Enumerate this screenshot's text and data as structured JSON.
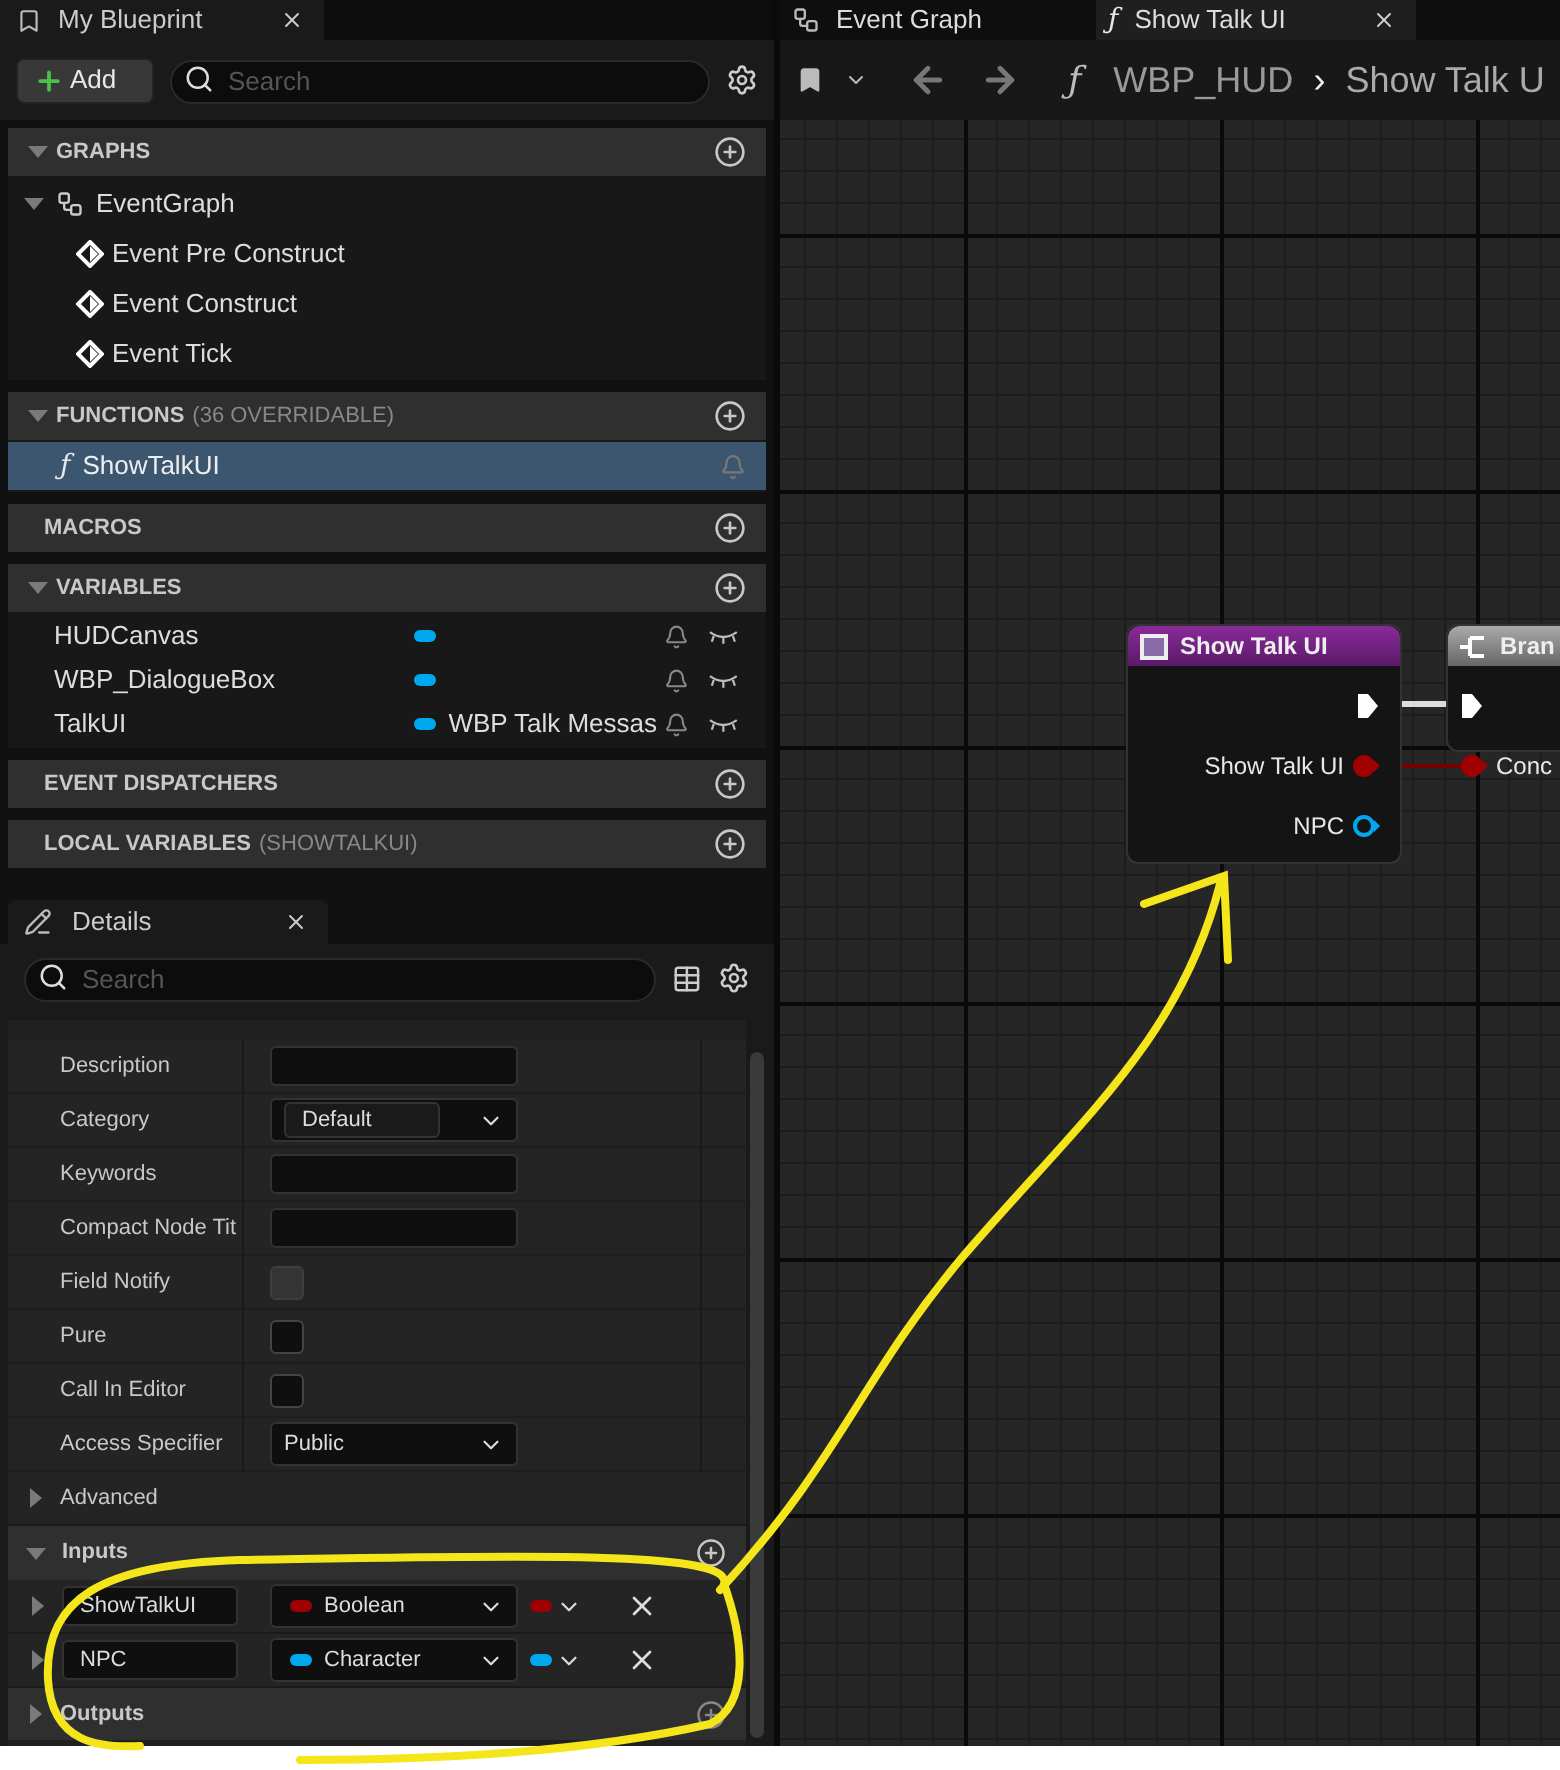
{
  "my_blueprint": {
    "tab_title": "My Blueprint",
    "add_label": "Add",
    "search_placeholder": "Search",
    "sections": [
      {
        "title": "GRAPHS",
        "expanded": true,
        "items": [
          {
            "kind": "graph",
            "label": "EventGraph",
            "expanded": true,
            "children": [
              {
                "kind": "event",
                "label": "Event Pre Construct"
              },
              {
                "kind": "event",
                "label": "Event Construct"
              },
              {
                "kind": "event",
                "label": "Event Tick"
              }
            ]
          }
        ]
      },
      {
        "title": "FUNCTIONS",
        "note": "(36 OVERRIDABLE)",
        "expanded": true,
        "items": [
          {
            "kind": "function",
            "glyph": "ƒ",
            "label": "ShowTalkUI",
            "selected": true
          }
        ]
      },
      {
        "title": "MACROS"
      },
      {
        "title": "VARIABLES",
        "expanded": true,
        "items": [
          {
            "kind": "variable",
            "label": "HUDCanvas"
          },
          {
            "kind": "variable",
            "label": "WBP_DialogueBox"
          },
          {
            "kind": "variable",
            "label": "TalkUI",
            "type": "WBP Talk Messas"
          }
        ]
      },
      {
        "title": "EVENT DISPATCHERS"
      },
      {
        "title": "LOCAL VARIABLES",
        "note": "(SHOWTALKUI)"
      }
    ]
  },
  "details": {
    "tab_title": "Details",
    "search_placeholder": "Search",
    "properties": [
      {
        "kind": "text",
        "label": "Description"
      },
      {
        "kind": "dropdown",
        "label": "Category",
        "value": "Default",
        "boxed": true
      },
      {
        "kind": "text",
        "label": "Keywords"
      },
      {
        "kind": "text",
        "label": "Compact Node Tit"
      },
      {
        "kind": "checkbox",
        "label": "Field Notify",
        "checked": false,
        "disabled": true
      },
      {
        "kind": "checkbox",
        "label": "Pure",
        "checked": false,
        "disabled": false
      },
      {
        "kind": "checkbox",
        "label": "Call In Editor",
        "checked": false,
        "disabled": false
      },
      {
        "kind": "dropdown",
        "label": "Access Specifier",
        "value": "Public",
        "boxed": false
      }
    ],
    "advanced": "Advanced",
    "inputs_title": "Inputs",
    "inputs": [
      {
        "name": "ShowTalkUI",
        "type": "Boolean",
        "color": "#a00000"
      },
      {
        "name": "NPC",
        "type": "Character",
        "color": "#00a8f0"
      }
    ],
    "outputs_title": "Outputs"
  },
  "graph_editor": {
    "tabs": [
      {
        "kind": "graph",
        "label": "Event Graph",
        "selected": false
      },
      {
        "kind": "function",
        "glyph": "ƒ",
        "label": "Show Talk UI",
        "selected": true
      }
    ],
    "breadcrumb_glyph": "ƒ",
    "breadcrumb": [
      "WBP_HUD",
      "Show Talk U"
    ],
    "breadcrumb_separator": "›",
    "nodes": [
      {
        "kind": "function_entry",
        "title": "Show Talk UI",
        "pins": [
          {
            "kind": "exec"
          },
          {
            "kind": "data",
            "label": "Show Talk UI",
            "color": "#a00000",
            "connected": true
          },
          {
            "kind": "data",
            "label": "NPC",
            "color": "#00a8f0",
            "connected": false
          }
        ]
      },
      {
        "kind": "branch",
        "title": "Bran",
        "pins": [
          {
            "kind": "exec"
          },
          {
            "kind": "data",
            "label": "Conc",
            "color": "#a00000",
            "connected": true
          }
        ]
      }
    ]
  }
}
